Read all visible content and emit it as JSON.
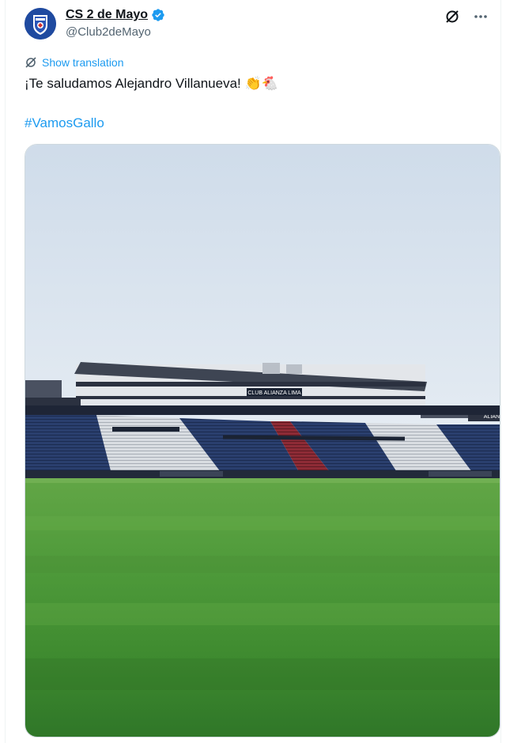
{
  "tweet": {
    "author_name": "CS 2 de Mayo",
    "author_handle": "@Club2deMayo",
    "verified": true,
    "translate_label": "Show translation",
    "text": "¡Te saludamos Alejandro Villanueva!",
    "text_emojis": "👏🐔",
    "hashtag": "#VamosGallo",
    "stadium_sign": "CLUB ALIANZA LIMA",
    "stadium_sign_right": "ALIAN"
  },
  "icons": {
    "top_right": [
      "grok-icon",
      "more-icon"
    ],
    "translate": "translate-icon"
  },
  "colors": {
    "accent": "#1d9bf0",
    "secondary_text": "#536471",
    "verified": "#1d9bf0"
  }
}
